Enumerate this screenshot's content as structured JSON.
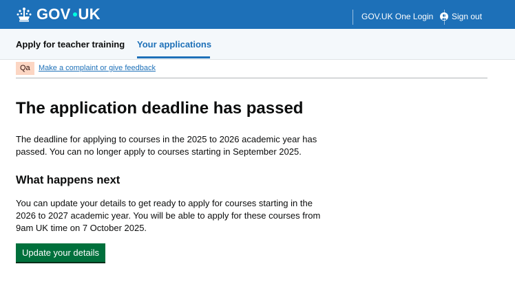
{
  "header": {
    "logo_text_left": "GOV",
    "logo_text_right": "UK",
    "account_link": "GOV.UK One Login",
    "sign_out": "Sign out",
    "icons": {
      "crown": "crown-icon",
      "user": "user-circle-icon"
    }
  },
  "service_nav": {
    "service_name": "Apply for teacher training",
    "active_link": "Your applications"
  },
  "phase_banner": {
    "tag": "Qa",
    "link": "Make a complaint or give feedback"
  },
  "main": {
    "title": "The application deadline has passed",
    "intro": "The deadline for applying to courses in the 2025 to 2026 academic year has passed. You can no longer apply to courses starting in September 2025.",
    "subheading": "What happens next",
    "next_text": "You can update your details to get ready to apply for courses starting in the 2026 to 2027 academic year. You will be able to apply for these courses from 9am UK time on 7 October 2025.",
    "button": "Update your details"
  },
  "colors": {
    "header_blue": "#1d70b8",
    "button_green": "#00703c",
    "phase_tag_bg": "#fcd6c3",
    "link_blue": "#1d70b8"
  }
}
